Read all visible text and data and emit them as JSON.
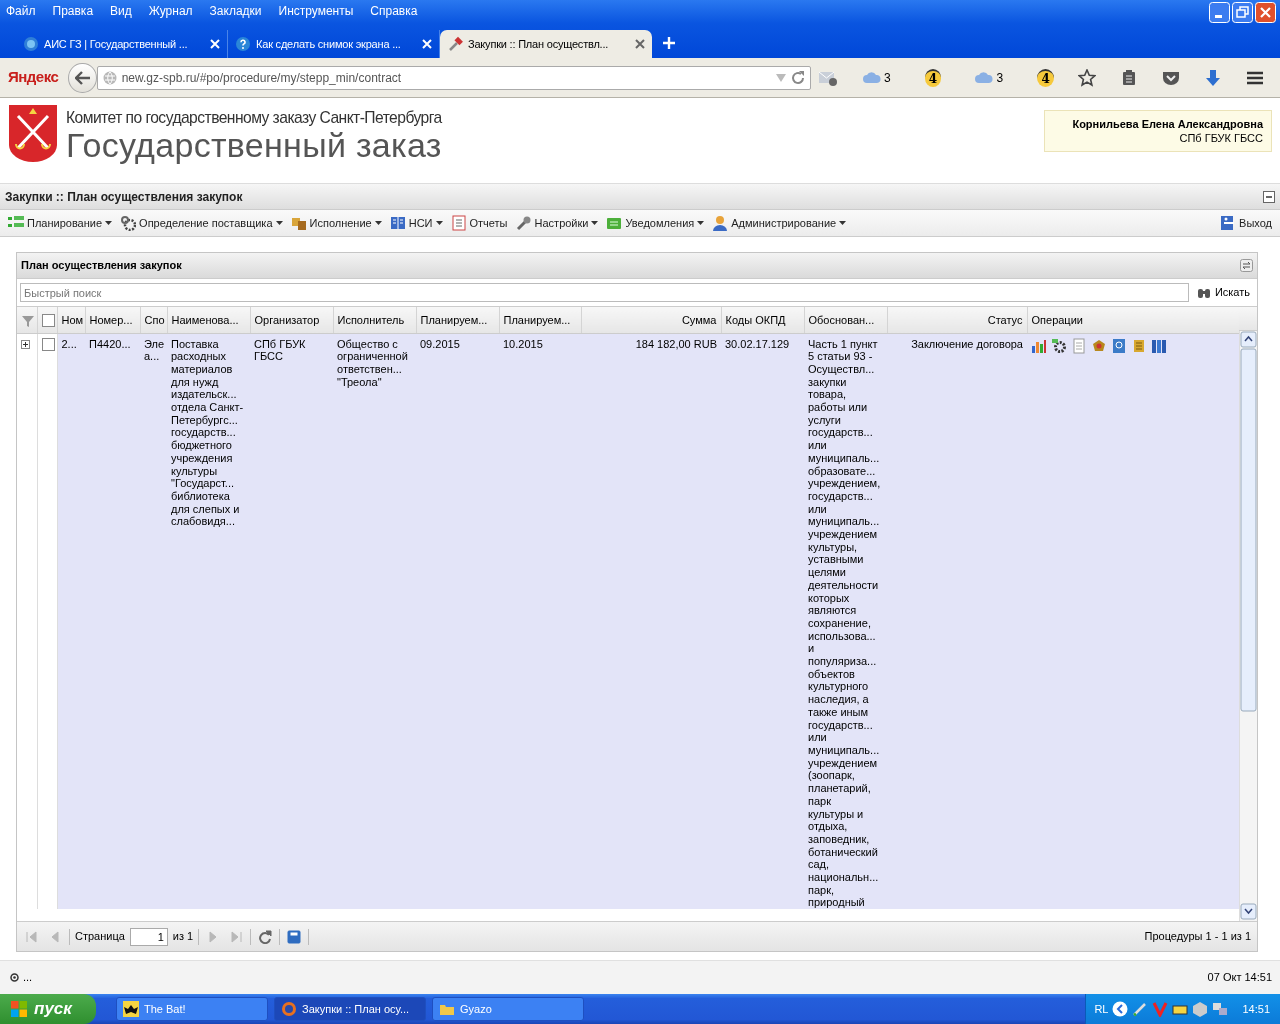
{
  "browser": {
    "menu": [
      "Файл",
      "Правка",
      "Вид",
      "Журнал",
      "Закладки",
      "Инструменты",
      "Справка"
    ],
    "tabs": [
      {
        "title": "АИС ГЗ | Государственный ...",
        "selected": false
      },
      {
        "title": "Как сделать снимок экрана ...",
        "selected": false
      },
      {
        "title": "Закупки :: План осуществл...",
        "selected": true
      }
    ],
    "search_engine": "Яндекс",
    "address": "new.gz-spb.ru/#po/procedure/my/stepp_min/contract",
    "widgets": [
      {
        "kind": "cloud",
        "count": "3"
      },
      {
        "kind": "badge",
        "count": "4"
      },
      {
        "kind": "cloud",
        "count": "3"
      },
      {
        "kind": "badge",
        "count": "4"
      }
    ]
  },
  "site": {
    "org": "Комитет по государственному заказу Санкт-Петербурга",
    "title": "Государственный заказ",
    "user": {
      "name": "Корнильева Елена Александровна",
      "org": "СПб ГБУК ГБСС"
    }
  },
  "page_title": "Закупки :: План осуществления закупок",
  "menu": [
    {
      "label": "Планирование",
      "dropdown": true
    },
    {
      "label": "Определение поставщика",
      "dropdown": true
    },
    {
      "label": "Исполнение",
      "dropdown": true
    },
    {
      "label": "НСИ",
      "dropdown": true
    },
    {
      "label": "Отчеты",
      "dropdown": false
    },
    {
      "label": "Настройки",
      "dropdown": true
    },
    {
      "label": "Уведомления",
      "dropdown": true
    },
    {
      "label": "Администрирование",
      "dropdown": true
    }
  ],
  "logout": "Выход",
  "grid": {
    "title": "План осуществления закупок",
    "search": {
      "placeholder": "Быстрый поиск",
      "button": "Искать"
    },
    "select_all": {
      "checked": false
    },
    "columns": [
      "Ном",
      "Номер...",
      "Спо",
      "Наименова...",
      "Организатор",
      "Исполнитель",
      "Планируем...",
      "Планируем...",
      "Сумма",
      "Коды ОКПД",
      "Обоснован...",
      "Статус",
      "Операции"
    ],
    "rows": [
      {
        "expanded": false,
        "checked": false,
        "selected": true,
        "cells": [
          "2...",
          "П4420...",
          "Эле\nа...",
          "Поставка\nрасходных\nматериалов\nдля нужд\nиздательск...\nотдела Санкт-\nПетербургс...\nгосударств...\nбюджетного\nучреждения\nкультуры\n\"Государст...\nбиблиотека\nдля слепых и\nслабовидя...",
          "СПб ГБУК\nГБСС",
          "Общество с\nограниченной\nответствен...\n\"Треола\"",
          "09.2015",
          "10.2015",
          "184 182,00 RUB",
          "30.02.17.129",
          "Часть 1 пункт\n5 статьи 93 -\nОсуществл...\nзакупки\nтовара,\nработы или\nуслуги\nгосударств...\nили\nмуниципаль...\nобразовате...\nучреждением,\nгосударств...\nили\nмуниципаль...\nучреждением\nкультуры,\nуставными\nцелями\nдеятельности\nкоторых\nявляются\nсохранение,\nиспользова...\nи\nпопуляриза...\nобъектов\nкультурного\nнаследия, а\nтакже иным\nгосударств...\nили\nмуниципаль...\nучреждением\n(зоопарк,\nпланетарий,\nпарк\nкультуры и\nотдыха,\nзаповедник,\nботанический\nсад,\nнациональн...\nпарк,\nприродный",
          "Заключение договора"
        ]
      }
    ],
    "pager": {
      "buttons": [
        {
          "kind": "first",
          "disabled": true
        },
        {
          "kind": "prev",
          "disabled": true
        },
        {
          "kind": "next",
          "disabled": true
        },
        {
          "kind": "last",
          "disabled": true
        },
        {
          "kind": "refresh",
          "disabled": false
        },
        {
          "kind": "save",
          "disabled": false
        }
      ],
      "page_label": "Страница",
      "page": "1",
      "of": "из 1",
      "summary": "Процедуры 1 - 1 из 1"
    }
  },
  "status_bar": {
    "left": "...",
    "right": "07 Окт 14:51"
  },
  "taskbar": {
    "start": "пуск",
    "tasks": [
      {
        "label": "The Bat!",
        "selected": false
      },
      {
        "label": "Закупки :: План осу...",
        "selected": true
      },
      {
        "label": "Gyazo",
        "selected": false
      }
    ],
    "lang": "RL",
    "clock": "14:51"
  }
}
